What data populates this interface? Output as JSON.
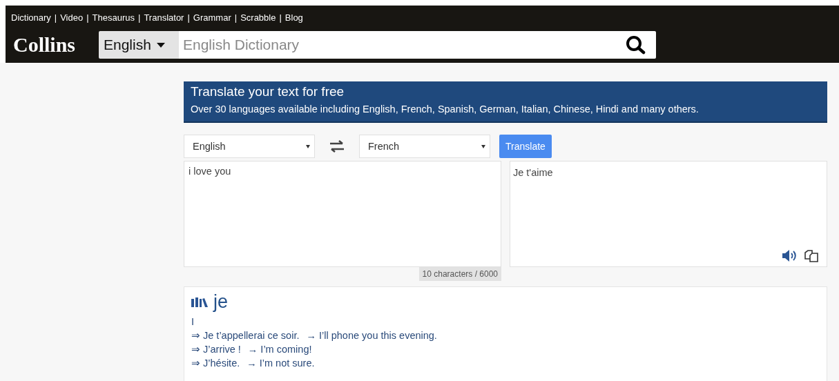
{
  "header": {
    "nav_links": [
      "Dictionary",
      "Video",
      "Thesaurus",
      "Translator",
      "Grammar",
      "Scrabble",
      "Blog"
    ],
    "separator": "|",
    "logo": "Collins",
    "language": "English",
    "search": {
      "placeholder": "English Dictionary"
    }
  },
  "banner": {
    "title": "Translate your text for free",
    "subtitle": "Over 30 languages available including English, French, Spanish, German, Italian, Chinese, Hindi and many others."
  },
  "translator": {
    "source_language": "English",
    "target_language": "French",
    "button": "Translate",
    "source_text": "i love you",
    "result_text": "Je t'aime",
    "counter": "10 characters / 6000"
  },
  "entry": {
    "headword": "je",
    "sense": "I",
    "examples": [
      {
        "fr": "⇒ Je t’appellerai ce soir.",
        "en": "→ I’ll phone you this evening."
      },
      {
        "fr": "⇒ J’arrive !",
        "en": "→ I’m coming!"
      },
      {
        "fr": "⇒ J’hésite.",
        "en": "→ I’m not sure."
      }
    ]
  }
}
